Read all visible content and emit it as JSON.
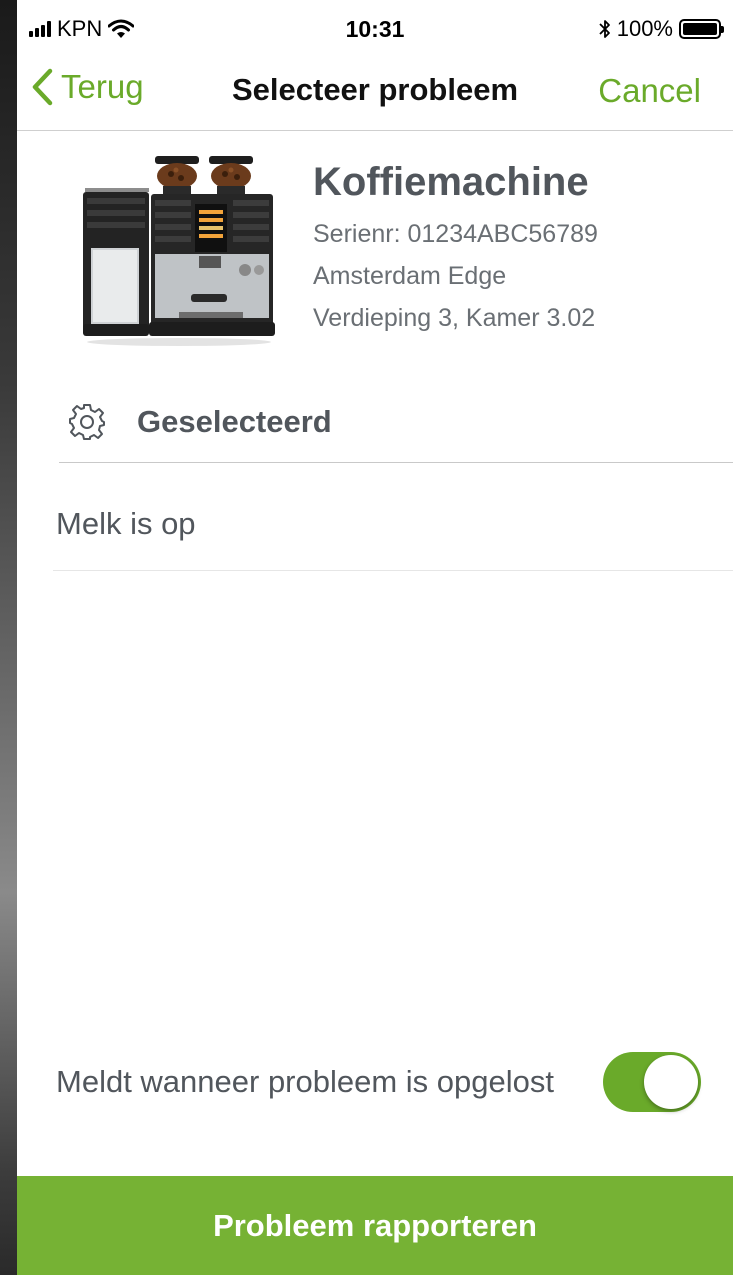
{
  "status_bar": {
    "carrier": "KPN",
    "time": "10:31",
    "battery": "100%",
    "battery_level": 1.0,
    "icons": [
      "signal-icon",
      "wifi-icon",
      "bluetooth-icon",
      "battery-icon"
    ]
  },
  "nav": {
    "back_label": "Terug",
    "title": "Selecteer probleem",
    "cancel_label": "Cancel"
  },
  "product": {
    "name": "Koffiemachine",
    "serial": "Serienr: 01234ABC56789",
    "location": "Amsterdam Edge",
    "room": "Verdieping 3, Kamer 3.02"
  },
  "selection": {
    "header": "Geselecteerd",
    "icon": "gear-icon",
    "items": [
      "Melk is op"
    ]
  },
  "notify": {
    "label": "Meldt wanneer probleem is opgelost",
    "enabled": true
  },
  "report_button": "Probleem rapporteren",
  "colors": {
    "accent": "#6aaa2a",
    "button": "#76b234",
    "text": "#51565c"
  }
}
